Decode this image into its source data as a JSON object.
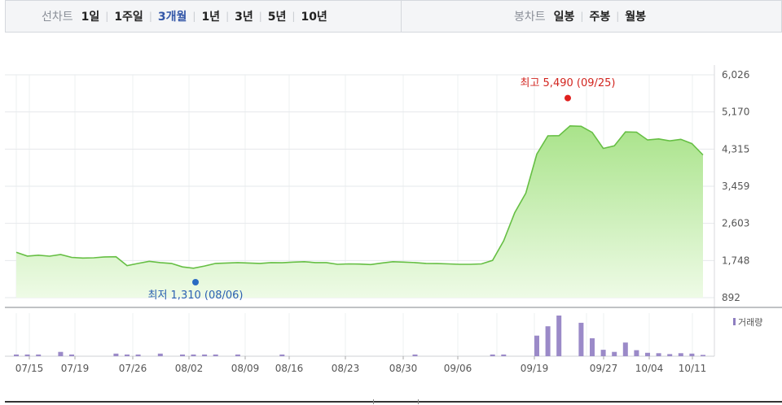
{
  "tabs": {
    "group1_label": "선차트",
    "group1": [
      {
        "label": "1일",
        "active": false
      },
      {
        "label": "1주일",
        "active": false
      },
      {
        "label": "3개월",
        "active": true
      },
      {
        "label": "1년",
        "active": false
      },
      {
        "label": "3년",
        "active": false
      },
      {
        "label": "5년",
        "active": false
      },
      {
        "label": "10년",
        "active": false
      }
    ],
    "group2_label": "봉차트",
    "group2": [
      {
        "label": "일봉",
        "active": false
      },
      {
        "label": "주봉",
        "active": false
      },
      {
        "label": "월봉",
        "active": false
      }
    ]
  },
  "chart_data": {
    "type": "area",
    "y_ticks": [
      "6,026",
      "5,170",
      "4,315",
      "3,459",
      "2,603",
      "1,748",
      "892"
    ],
    "ylim": [
      892,
      6026
    ],
    "x_ticks": [
      "07/15",
      "07/19",
      "07/26",
      "08/02",
      "08/09",
      "08/16",
      "08/23",
      "08/30",
      "09/06",
      "09/19",
      "09/27",
      "10/04",
      "10/11"
    ],
    "high_label": "최고 5,490 (09/25)",
    "low_label": "최저 1,310 (08/06)",
    "high_value": 5490,
    "low_value": 1310,
    "volume_label": "거래량",
    "price_series": [
      1938,
      1850,
      1870,
      1848,
      1885,
      1820,
      1805,
      1810,
      1830,
      1835,
      1630,
      1680,
      1730,
      1700,
      1680,
      1600,
      1570,
      1620,
      1680,
      1690,
      1700,
      1690,
      1680,
      1700,
      1695,
      1710,
      1720,
      1700,
      1700,
      1660,
      1670,
      1665,
      1655,
      1690,
      1720,
      1710,
      1700,
      1680,
      1678,
      1670,
      1660,
      1660,
      1670,
      1750,
      2200,
      2850,
      3300,
      4200,
      4620,
      4625,
      4850,
      4840,
      4700,
      4330,
      4390,
      4710,
      4705,
      4525,
      4550,
      4505,
      4540,
      4440,
      4180
    ],
    "volume_series": [
      4,
      4,
      4,
      0,
      10,
      4,
      0,
      0,
      0,
      6,
      4,
      4,
      0,
      0,
      6,
      0,
      4,
      4,
      4,
      4,
      0,
      0,
      4,
      0,
      0,
      0,
      0,
      0,
      4,
      0,
      0,
      0,
      0,
      0,
      0,
      0,
      0,
      0,
      0,
      0,
      0,
      0,
      0,
      0,
      0,
      0,
      0,
      4,
      0,
      0,
      0,
      0,
      0,
      0,
      0,
      0,
      0,
      0,
      0,
      0,
      0,
      0,
      0,
      0,
      0,
      0,
      0,
      0,
      0,
      0,
      0,
      0,
      0,
      0,
      0,
      0,
      0,
      0,
      0,
      0,
      0,
      0,
      0,
      0,
      0,
      0,
      0,
      0,
      0,
      4,
      4,
      4,
      4,
      0,
      0,
      0,
      0,
      0,
      0,
      0,
      0,
      0,
      0,
      0,
      0,
      0,
      0,
      0,
      0,
      0,
      0,
      0,
      0,
      0,
      0,
      0,
      0,
      0,
      0,
      0,
      0,
      0,
      0,
      0,
      0,
      0,
      0,
      0,
      0,
      0,
      0,
      0
    ],
    "volume_bars": [
      4,
      4,
      4,
      0,
      10,
      4,
      0,
      0,
      0,
      6,
      4,
      4,
      0,
      6,
      0,
      4,
      4,
      4,
      4,
      0,
      4,
      0,
      0,
      0,
      4,
      0,
      0,
      0,
      0,
      0,
      0,
      0,
      0,
      0,
      0,
      0,
      4,
      0,
      0,
      0,
      0,
      0,
      0,
      4,
      4,
      0,
      0,
      48,
      70,
      95,
      0,
      78,
      42,
      15,
      10,
      32,
      14,
      8,
      7,
      5,
      7,
      6,
      3
    ]
  }
}
